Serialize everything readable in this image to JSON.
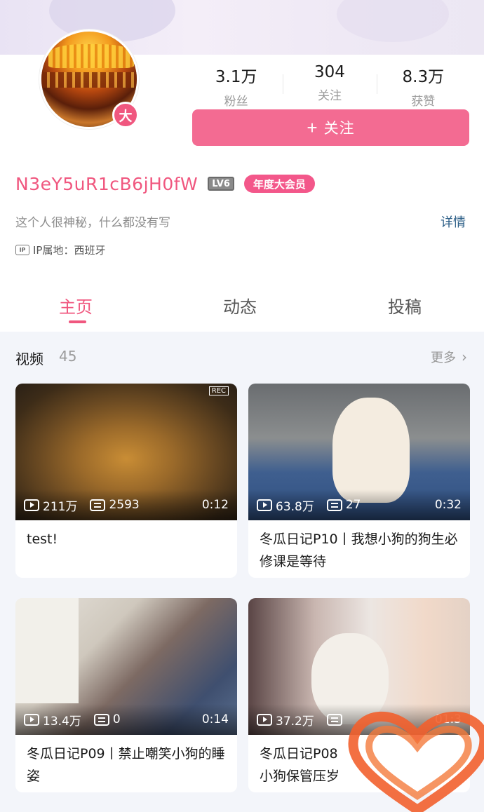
{
  "stats": [
    {
      "value": "3.1万",
      "label": "粉丝"
    },
    {
      "value": "304",
      "label": "关注"
    },
    {
      "value": "8.3万",
      "label": "获赞"
    }
  ],
  "avatar_badge": "大",
  "follow_button": {
    "icon": "+",
    "label": "关注"
  },
  "user": {
    "name": "N3eY5uR1cB6jH0fW",
    "level": "LV6",
    "vip": "年度大会员",
    "bio": "这个人很神秘，什么都没有写",
    "detail_link": "详情",
    "ip_icon": "IP",
    "ip_location": "IP属地：西班牙"
  },
  "tabs": [
    {
      "label": "主页",
      "active": true
    },
    {
      "label": "动态",
      "active": false
    },
    {
      "label": "投稿",
      "active": false
    }
  ],
  "section": {
    "title": "视频",
    "count": "45",
    "more": "更多"
  },
  "videos": [
    {
      "views": "211万",
      "danmaku": "2593",
      "duration": "0:12",
      "title": "test!",
      "rec": "REC"
    },
    {
      "views": "63.8万",
      "danmaku": "27",
      "duration": "0:32",
      "title": "冬瓜日记P10丨我想小狗的狗生必修课是等待"
    },
    {
      "views": "13.4万",
      "danmaku": "0",
      "duration": "0:14",
      "title": "冬瓜日记P09丨禁止嘲笑小狗的睡姿"
    },
    {
      "views": "37.2万",
      "danmaku": "",
      "duration": "01:3",
      "title": "冬瓜日记P08\n小狗保管压岁"
    }
  ],
  "colors": {
    "accent": "#f0577f",
    "follow_button": "#f36b92",
    "link": "#2a5d86"
  }
}
